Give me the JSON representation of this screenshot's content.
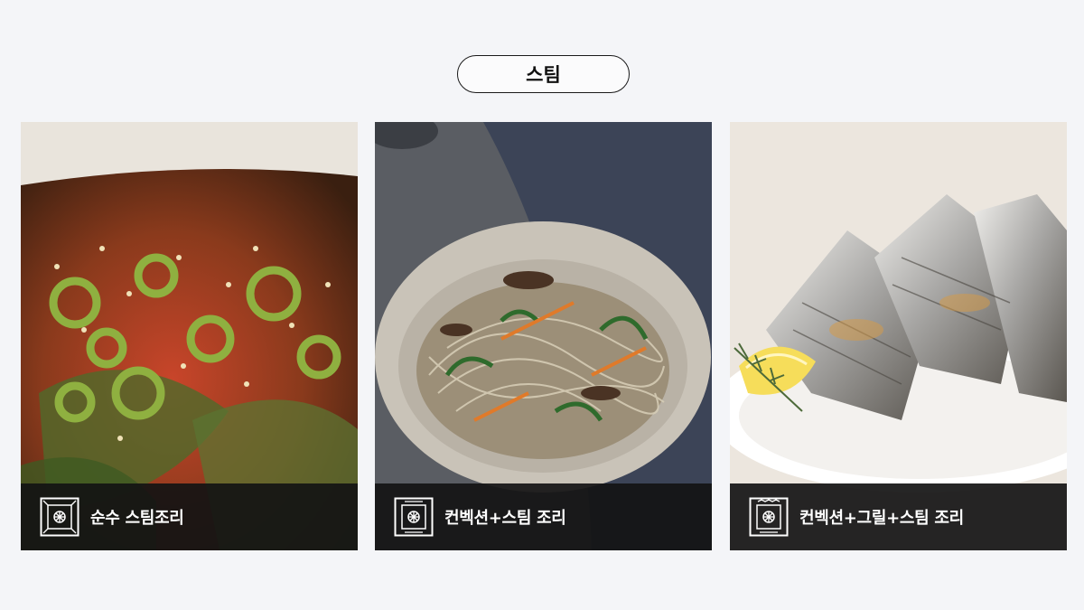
{
  "mode_title": "스팀",
  "cards": [
    {
      "label": "순수 스팀조리",
      "icon": "oven-steam-icon",
      "image": "kimchi-perilla-leaves-image"
    },
    {
      "label": "컨벡션+스팀 조리",
      "icon": "oven-convection-steam-icon",
      "image": "japchae-glass-noodles-image"
    },
    {
      "label": "컨벡션+그릴+스팀 조리",
      "icon": "oven-convection-grill-steam-icon",
      "image": "grilled-hairtail-fish-image"
    }
  ],
  "colors": {
    "background": "#f4f5f8",
    "pill_border": "#1a1a1a",
    "caption_bar": "#141414",
    "caption_text": "#ffffff"
  }
}
